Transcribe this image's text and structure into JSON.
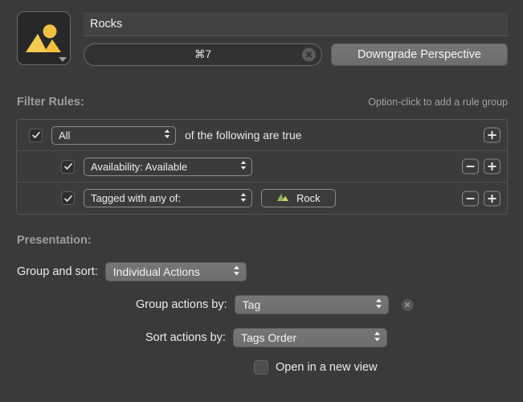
{
  "header": {
    "icon_name": "perspective-image-icon",
    "name_value": "Rocks",
    "shortcut_value": "⌘7",
    "downgrade_label": "Downgrade Perspective"
  },
  "filter": {
    "section_label": "Filter Rules:",
    "hint": "Option-click to add a rule group",
    "group_row": {
      "checked": true,
      "match_value": "All",
      "suffix_text": "of the following are true",
      "add_label": "+"
    },
    "rules": [
      {
        "checked": true,
        "criterion": "Availability: Available",
        "remove_label": "−",
        "add_label": "+"
      },
      {
        "checked": true,
        "criterion": "Tagged with any of:",
        "tag_label": "Rock",
        "tag_icon": "mountain-tag-icon",
        "remove_label": "−",
        "add_label": "+"
      }
    ]
  },
  "presentation": {
    "section_label": "Presentation:",
    "group_and_sort": {
      "label": "Group and sort:",
      "value": "Individual Actions"
    },
    "group_actions_by": {
      "label": "Group actions by:",
      "value": "Tag"
    },
    "sort_actions_by": {
      "label": "Sort actions by:",
      "value": "Tags Order"
    },
    "open_in_new_view": {
      "label": "Open in a new view",
      "checked": false
    }
  },
  "colors": {
    "background": "#3a3a3a",
    "accent_icon": "#f0c040",
    "text_primary": "#ececec",
    "text_secondary": "#9d9d9d",
    "button_face": "#6f6f6f"
  }
}
